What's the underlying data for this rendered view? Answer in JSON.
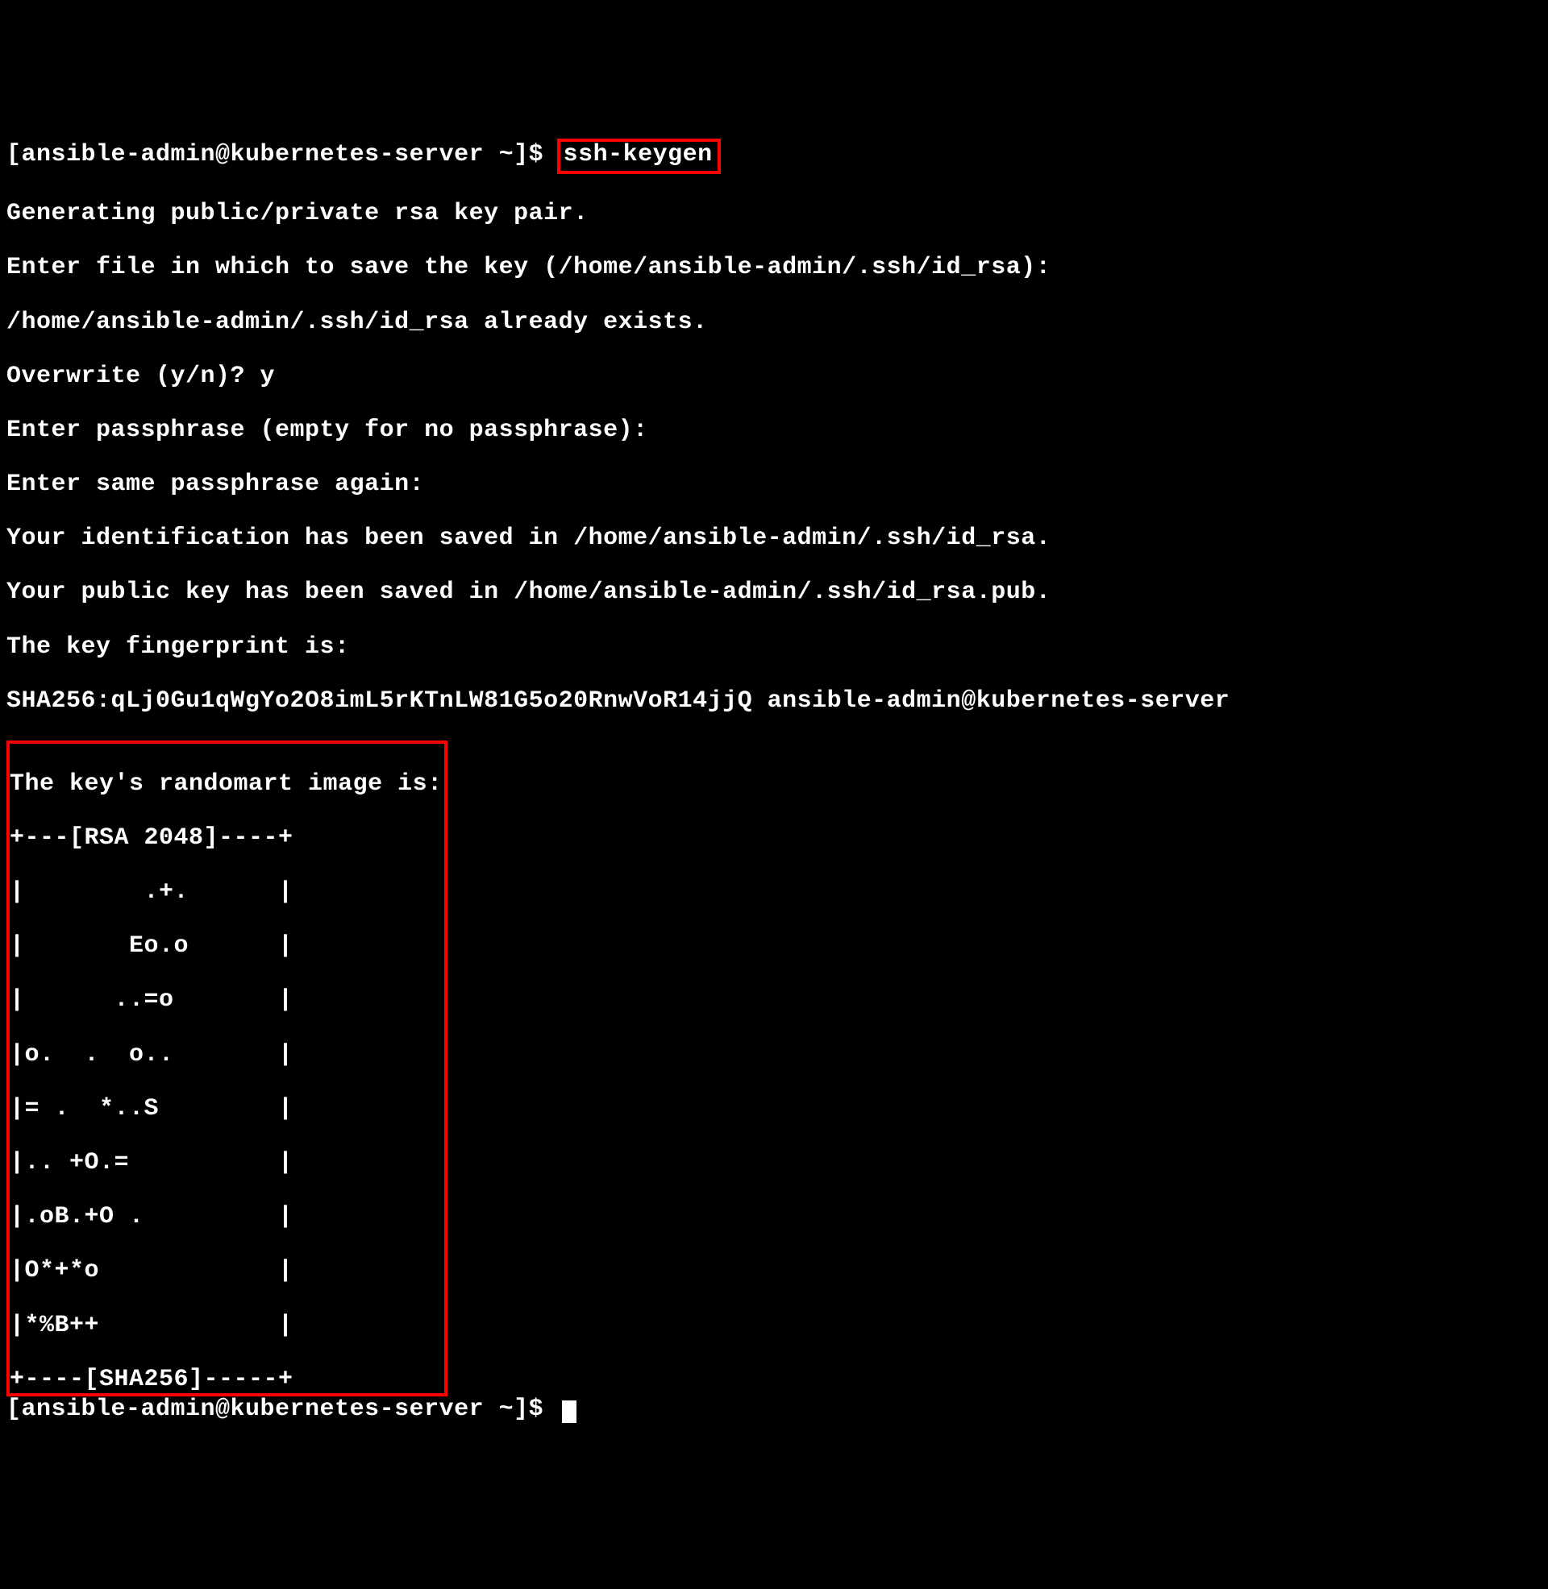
{
  "prompt1": "[ansible-admin@kubernetes-server ~]$ ",
  "command": "ssh-keygen",
  "output": {
    "line1": "Generating public/private rsa key pair.",
    "line2": "Enter file in which to save the key (/home/ansible-admin/.ssh/id_rsa):",
    "line3": "/home/ansible-admin/.ssh/id_rsa already exists.",
    "line4": "Overwrite (y/n)? y",
    "line5": "Enter passphrase (empty for no passphrase):",
    "line6": "Enter same passphrase again:",
    "line7": "Your identification has been saved in /home/ansible-admin/.ssh/id_rsa.",
    "line8": "Your public key has been saved in /home/ansible-admin/.ssh/id_rsa.pub.",
    "line9": "The key fingerprint is:",
    "line10": "SHA256:qLj0Gu1qWgYo2O8imL5rKTnLW81G5o20RnwVoR14jjQ ansible-admin@kubernetes-server"
  },
  "randomart": {
    "header": "The key's randomart image is:",
    "l01": "+---[RSA 2048]----+",
    "l02": "|        .+.      |",
    "l03": "|       Eo.o      |",
    "l04": "|      ..=o       |",
    "l05": "|o.  .  o..       |",
    "l06": "|= .  *..S        |",
    "l07": "|.. +O.=          |",
    "l08": "|.oB.+O .         |",
    "l09": "|O*+*o            |",
    "l10": "|*%B++            |",
    "l11": "+----[SHA256]-----+"
  },
  "prompt2": "[ansible-admin@kubernetes-server ~]$ "
}
